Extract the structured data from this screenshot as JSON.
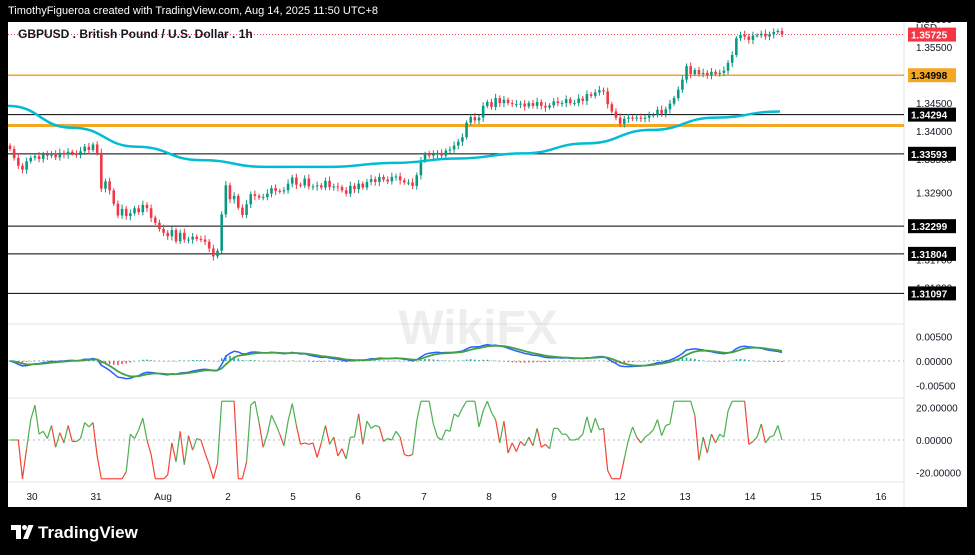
{
  "attribution": "TimothyFigueroa created with TradingView.com, Aug 14, 2025 11:50 UTC+8",
  "brand": "TradingView",
  "watermark": "WikiFX",
  "chart_data": {
    "type": "candlestick",
    "title": "GBPUSD . British Pound / U.S. Dollar . 1h",
    "currency": "USD",
    "price_axis": {
      "ylim": [
        1.3055,
        1.3595
      ],
      "ticks": [
        "1.36000",
        "1.35500",
        "1.34500",
        "1.34000",
        "1.33500",
        "1.32900",
        "1.31700",
        "1.31200"
      ]
    },
    "current_price": "1.35725",
    "horizontal_levels": [
      {
        "label": "1.34998",
        "value": 1.34998,
        "color": "#f5a623"
      },
      {
        "label": "1.34294",
        "value": 1.34294,
        "color": "#000000"
      },
      {
        "label": "1.34100",
        "value": 1.341,
        "color": "#f5a623"
      },
      {
        "label": "1.33593",
        "value": 1.33593,
        "color": "#000000"
      },
      {
        "label": "1.32299",
        "value": 1.32299,
        "color": "#000000"
      },
      {
        "label": "1.31804",
        "value": 1.31804,
        "color": "#000000"
      },
      {
        "label": "1.31097",
        "value": 1.31097,
        "color": "#000000"
      }
    ],
    "x_axis_labels": [
      "30",
      "31",
      "Aug",
      "2",
      "5",
      "6",
      "7",
      "8",
      "9",
      "12",
      "13",
      "14",
      "15",
      "16"
    ],
    "closes": [
      1.3368,
      1.3352,
      1.3338,
      1.3331,
      1.3346,
      1.3352,
      1.3355,
      1.335,
      1.3358,
      1.3356,
      1.336,
      1.3353,
      1.3361,
      1.3358,
      1.3363,
      1.336,
      1.3357,
      1.3364,
      1.3372,
      1.3366,
      1.3376,
      1.3361,
      1.3297,
      1.331,
      1.3294,
      1.327,
      1.3249,
      1.3261,
      1.3248,
      1.3253,
      1.3262,
      1.3255,
      1.3268,
      1.3262,
      1.3245,
      1.3236,
      1.3225,
      1.3218,
      1.3212,
      1.3223,
      1.3203,
      1.3218,
      1.3206,
      1.3206,
      1.3211,
      1.3207,
      1.3206,
      1.3202,
      1.319,
      1.3176,
      1.3186,
      1.3251,
      1.3303,
      1.3278,
      1.3284,
      1.3263,
      1.325,
      1.3269,
      1.3287,
      1.3284,
      1.3281,
      1.3282,
      1.3288,
      1.3298,
      1.3293,
      1.3292,
      1.3294,
      1.3306,
      1.3317,
      1.3304,
      1.3303,
      1.3315,
      1.3301,
      1.3301,
      1.3303,
      1.3299,
      1.3311,
      1.33,
      1.3301,
      1.33,
      1.3294,
      1.3288,
      1.3302,
      1.3296,
      1.3306,
      1.3299,
      1.3309,
      1.3314,
      1.3309,
      1.3318,
      1.3313,
      1.331,
      1.3318,
      1.3319,
      1.3312,
      1.3308,
      1.3308,
      1.3302,
      1.3321,
      1.3347,
      1.3359,
      1.3356,
      1.3358,
      1.3361,
      1.3356,
      1.3365,
      1.3367,
      1.3374,
      1.3381,
      1.3389,
      1.3415,
      1.3425,
      1.3419,
      1.3424,
      1.3445,
      1.3452,
      1.3443,
      1.3459,
      1.345,
      1.3456,
      1.345,
      1.3448,
      1.3448,
      1.3449,
      1.3444,
      1.345,
      1.3445,
      1.3452,
      1.3445,
      1.3442,
      1.3446,
      1.3453,
      1.345,
      1.345,
      1.3457,
      1.345,
      1.345,
      1.3458,
      1.3454,
      1.3466,
      1.3463,
      1.3469,
      1.3473,
      1.3471,
      1.3448,
      1.3435,
      1.3424,
      1.3413,
      1.3422,
      1.3424,
      1.3422,
      1.3424,
      1.3422,
      1.3424,
      1.3428,
      1.3429,
      1.3438,
      1.3431,
      1.3439,
      1.3449,
      1.3459,
      1.3474,
      1.3492,
      1.3516,
      1.3502,
      1.3509,
      1.3502,
      1.3504,
      1.35,
      1.3506,
      1.3502,
      1.3504,
      1.3508,
      1.3522,
      1.3536,
      1.3566,
      1.3572,
      1.3569,
      1.3563,
      1.3571,
      1.3571,
      1.3574,
      1.3569,
      1.3573,
      1.3577,
      1.3579,
      1.3573
    ],
    "ma_line": {
      "color": "#00bcd4",
      "values": [
        1.3445,
        1.3406,
        1.3372,
        1.3348,
        1.3336,
        1.3336,
        1.3343,
        1.3351,
        1.336,
        1.3378,
        1.3402,
        1.3424,
        1.3435
      ]
    },
    "oscillator_1": {
      "ticks": [
        "0.00500",
        "0.00000",
        "-0.00500"
      ],
      "ylim": [
        -0.0075,
        0.0075
      ]
    },
    "oscillator_2": {
      "ticks": [
        "20.00000",
        "0.00000",
        "-20.00000"
      ],
      "ylim": [
        -26,
        26
      ]
    }
  }
}
